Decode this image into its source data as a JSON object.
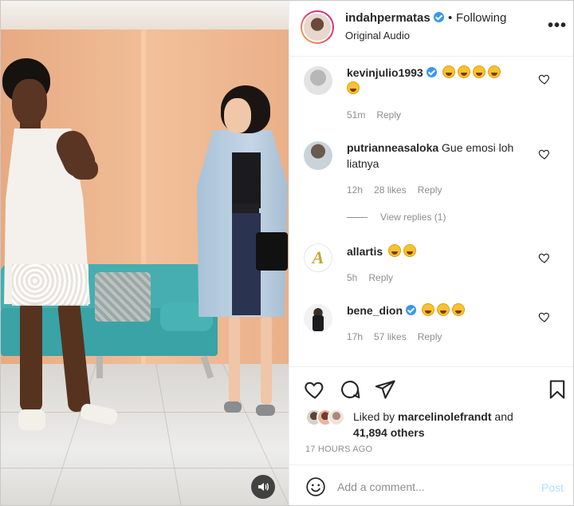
{
  "header": {
    "username": "indahpermatas",
    "separator": "•",
    "follow_status": "Following",
    "audio": "Original Audio",
    "more_icon": "more-horizontal-icon"
  },
  "comments": [
    {
      "username": "kevinjulio1993",
      "verified": true,
      "text": "",
      "emojis": 5,
      "time": "51m",
      "likes": "",
      "reply": "Reply"
    },
    {
      "username": "putrianneasaloka",
      "verified": false,
      "text": "Gue emosi loh liatnya",
      "emojis": 0,
      "time": "12h",
      "likes": "28 likes",
      "reply": "Reply",
      "view_replies": "View replies (1)"
    },
    {
      "username": "allartis",
      "verified": false,
      "text": "",
      "emojis": 2,
      "time": "5h",
      "likes": "",
      "reply": "Reply"
    },
    {
      "username": "bene_dion",
      "verified": true,
      "text": "",
      "emojis": 3,
      "time": "17h",
      "likes": "57 likes",
      "reply": "Reply"
    }
  ],
  "actions": {
    "like_icon": "heart-icon",
    "comment_icon": "comment-icon",
    "share_icon": "send-icon",
    "save_icon": "bookmark-icon"
  },
  "likes": {
    "prefix": "Liked by",
    "user": "marcelinolefrandt",
    "and": "and",
    "count": "41,894 others"
  },
  "timestamp": "17 HOURS AGO",
  "composer": {
    "placeholder": "Add a comment...",
    "post_label": "Post"
  },
  "colors": {
    "verified": "#3897f0",
    "post_disabled": "#b2dffc",
    "muted": "#8e8e8e"
  }
}
